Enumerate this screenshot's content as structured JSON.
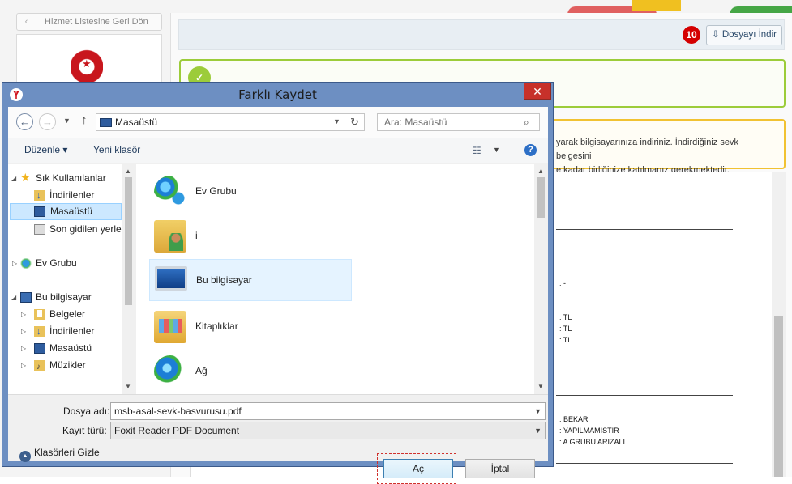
{
  "background": {
    "back_button": "Hizmet Listesine Geri Dön",
    "step_badge": "10",
    "download_button": "Dosyayı İndir",
    "info_text_line1": "yarak bilgisayarınıza indiriniz. İndirdiğiniz sevk belgesini",
    "info_text_line2": "e kadar birliğinize katılmanız gerekmektedir.",
    "fields": [
      ": -",
      ":  TL",
      ":      TL",
      ":  TL",
      ": BEKAR",
      ": YAPILMAMISTIR",
      ": A GRUBU ARIZALI"
    ]
  },
  "dialog": {
    "title": "Farklı Kaydet",
    "close": "✕",
    "address": "Masaüstü",
    "search_placeholder": "Ara: Masaüstü",
    "toolbar": {
      "organize": "Düzenle ▾",
      "new_folder": "Yeni klasör"
    },
    "tree": [
      {
        "label": "Sık Kullanılanlar",
        "icon": "star-icon"
      },
      {
        "label": "İndirilenler",
        "icon": "downloads-folder-icon"
      },
      {
        "label": "Masaüstü",
        "icon": "desktop-icon",
        "selected": true
      },
      {
        "label": "Son gidilen yerler",
        "icon": "recent-places-icon"
      },
      {
        "label": "Ev Grubu",
        "icon": "homegroup-icon"
      },
      {
        "label": "Bu bilgisayar",
        "icon": "computer-icon"
      },
      {
        "label": "Belgeler",
        "icon": "documents-folder-icon"
      },
      {
        "label": "İndirilenler",
        "icon": "downloads-folder-icon"
      },
      {
        "label": "Masaüstü",
        "icon": "desktop-icon"
      },
      {
        "label": "Müzikler",
        "icon": "music-folder-icon"
      }
    ],
    "items": [
      {
        "label": "Ev Grubu",
        "icon": "homegroup-icon"
      },
      {
        "label": "i",
        "icon": "user-folder-icon"
      },
      {
        "label": "Bu bilgisayar",
        "icon": "computer-icon",
        "selected": true
      },
      {
        "label": "Kitaplıklar",
        "icon": "libraries-icon"
      },
      {
        "label": "Ağ",
        "icon": "network-icon"
      }
    ],
    "filename_label": "Dosya adı:",
    "filename_value": "msb-asal-sevk-basvurusu.pdf",
    "type_label": "Kayıt türü:",
    "type_value": "Foxit Reader PDF Document",
    "hide_folders": "Klasörleri Gizle",
    "open_button": "Aç",
    "cancel_button": "İptal"
  },
  "colors": {
    "accent": "#6d8fc2",
    "close": "#c7312a",
    "badge": "#d40000"
  }
}
